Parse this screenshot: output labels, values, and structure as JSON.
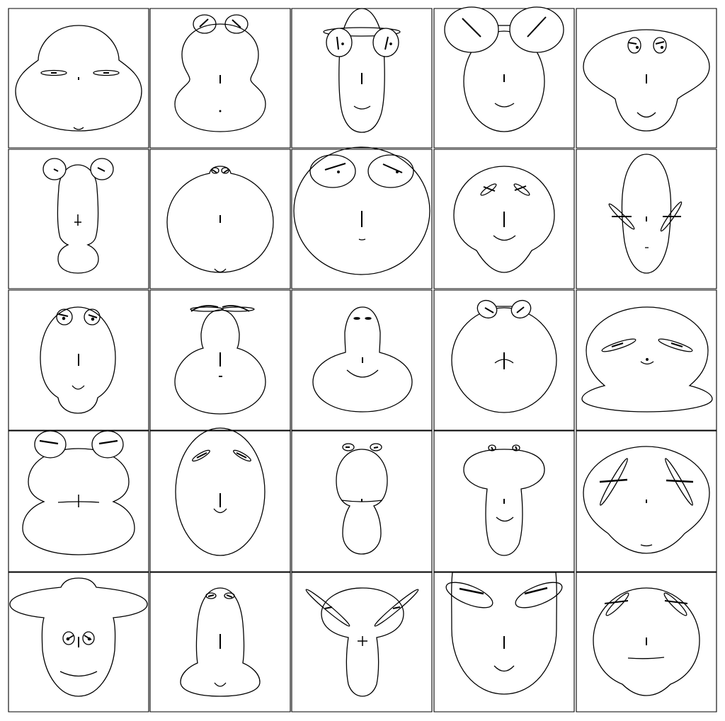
{
  "figure": {
    "type": "chernoff-faces",
    "rows": 5,
    "columns": 5,
    "background": "#ffffff",
    "stroke": "#000000",
    "faces": [
      {
        "id": "r1c1",
        "head": "wide-dome",
        "eyes": "flat-narrow",
        "brows": "none",
        "nose": "dot",
        "mouth": "tiny-chin-smile"
      },
      {
        "id": "r1c2",
        "head": "gourd",
        "eyes": "raised-round-small",
        "brows": "slanted",
        "nose": "line",
        "mouth": "dot"
      },
      {
        "id": "r1c3",
        "head": "tall-oval-peaked",
        "eyes": "large-upright",
        "brows": "halo",
        "nose": "line",
        "mouth": "smile"
      },
      {
        "id": "r1c4",
        "head": "round",
        "eyes": "huge-top",
        "brows": "long-slanted",
        "nose": "short",
        "mouth": "smile"
      },
      {
        "id": "r1c5",
        "head": "mushroom",
        "eyes": "small-round",
        "brows": "none",
        "nose": "line",
        "mouth": "smile"
      },
      {
        "id": "r2c1",
        "head": "peanut-narrow",
        "eyes": "raised-round",
        "brows": "short",
        "nose": "cross",
        "mouth": "none"
      },
      {
        "id": "r2c2",
        "head": "round-bump-top",
        "eyes": "tiny",
        "brows": "none",
        "nose": "short",
        "mouth": "tiny-chin-smile"
      },
      {
        "id": "r2c3",
        "head": "large-circle",
        "eyes": "large-ellipse",
        "brows": "long",
        "nose": "line",
        "mouth": "tiny"
      },
      {
        "id": "r2c4",
        "head": "round-jaw",
        "eyes": "slanted-ellipse",
        "brows": "crossed",
        "nose": "line",
        "mouth": "smile"
      },
      {
        "id": "r2c5",
        "head": "narrow-tall",
        "eyes": "long-diagonal",
        "brows": "horizontal",
        "nose": "short",
        "mouth": "dot"
      },
      {
        "id": "r3c1",
        "head": "egg",
        "eyes": "round-upper",
        "brows": "short",
        "nose": "line",
        "mouth": "small-smile"
      },
      {
        "id": "r3c2",
        "head": "gourd-large",
        "eyes": "flat-wide",
        "brows": "arched",
        "nose": "line",
        "mouth": "dash"
      },
      {
        "id": "r3c3",
        "head": "bell",
        "eyes": "tiny-dashes",
        "brows": "none",
        "nose": "short",
        "mouth": "wide-smile"
      },
      {
        "id": "r3c4",
        "head": "circle-ears",
        "eyes": "raised-slanted",
        "brows": "short",
        "nose": "cross",
        "mouth": "frown-line"
      },
      {
        "id": "r3c5",
        "head": "wide-pillow",
        "eyes": "wide-slanted",
        "brows": "short",
        "nose": "dot",
        "mouth": "small-smile"
      },
      {
        "id": "r4c1",
        "head": "stacked-wide",
        "eyes": "round-top",
        "brows": "bold",
        "nose": "cross",
        "mouth": "wide-line"
      },
      {
        "id": "r4c2",
        "head": "tall-oval",
        "eyes": "slanted",
        "brows": "short",
        "nose": "line",
        "mouth": "small-smile"
      },
      {
        "id": "r4c3",
        "head": "peanut-medium",
        "eyes": "tiny-round",
        "brows": "none",
        "nose": "short",
        "mouth": "wide-line"
      },
      {
        "id": "r4c4",
        "head": "mushroom-narrow",
        "eyes": "tiny-round",
        "brows": "none",
        "nose": "short",
        "mouth": "smile"
      },
      {
        "id": "r4c5",
        "head": "wide-round",
        "eyes": "long-diagonal",
        "brows": "bold-horizontal",
        "nose": "dot",
        "mouth": "small-smile"
      },
      {
        "id": "r5c1",
        "head": "hat-brim",
        "eyes": "round-mid",
        "brows": "short",
        "nose": "line",
        "mouth": "wide-smile"
      },
      {
        "id": "r5c2",
        "head": "bottle",
        "eyes": "tiny",
        "brows": "none",
        "nose": "line",
        "mouth": "small-smile"
      },
      {
        "id": "r5c3",
        "head": "cone-wide-top",
        "eyes": "long-wing",
        "brows": "short",
        "nose": "cross",
        "mouth": "none"
      },
      {
        "id": "r5c4",
        "head": "oval-flat-top",
        "eyes": "long-wing",
        "brows": "bold",
        "nose": "line",
        "mouth": "smile"
      },
      {
        "id": "r5c5",
        "head": "round-flat-base",
        "eyes": "slanted",
        "brows": "crossed",
        "nose": "short",
        "mouth": "wide-line"
      }
    ]
  }
}
